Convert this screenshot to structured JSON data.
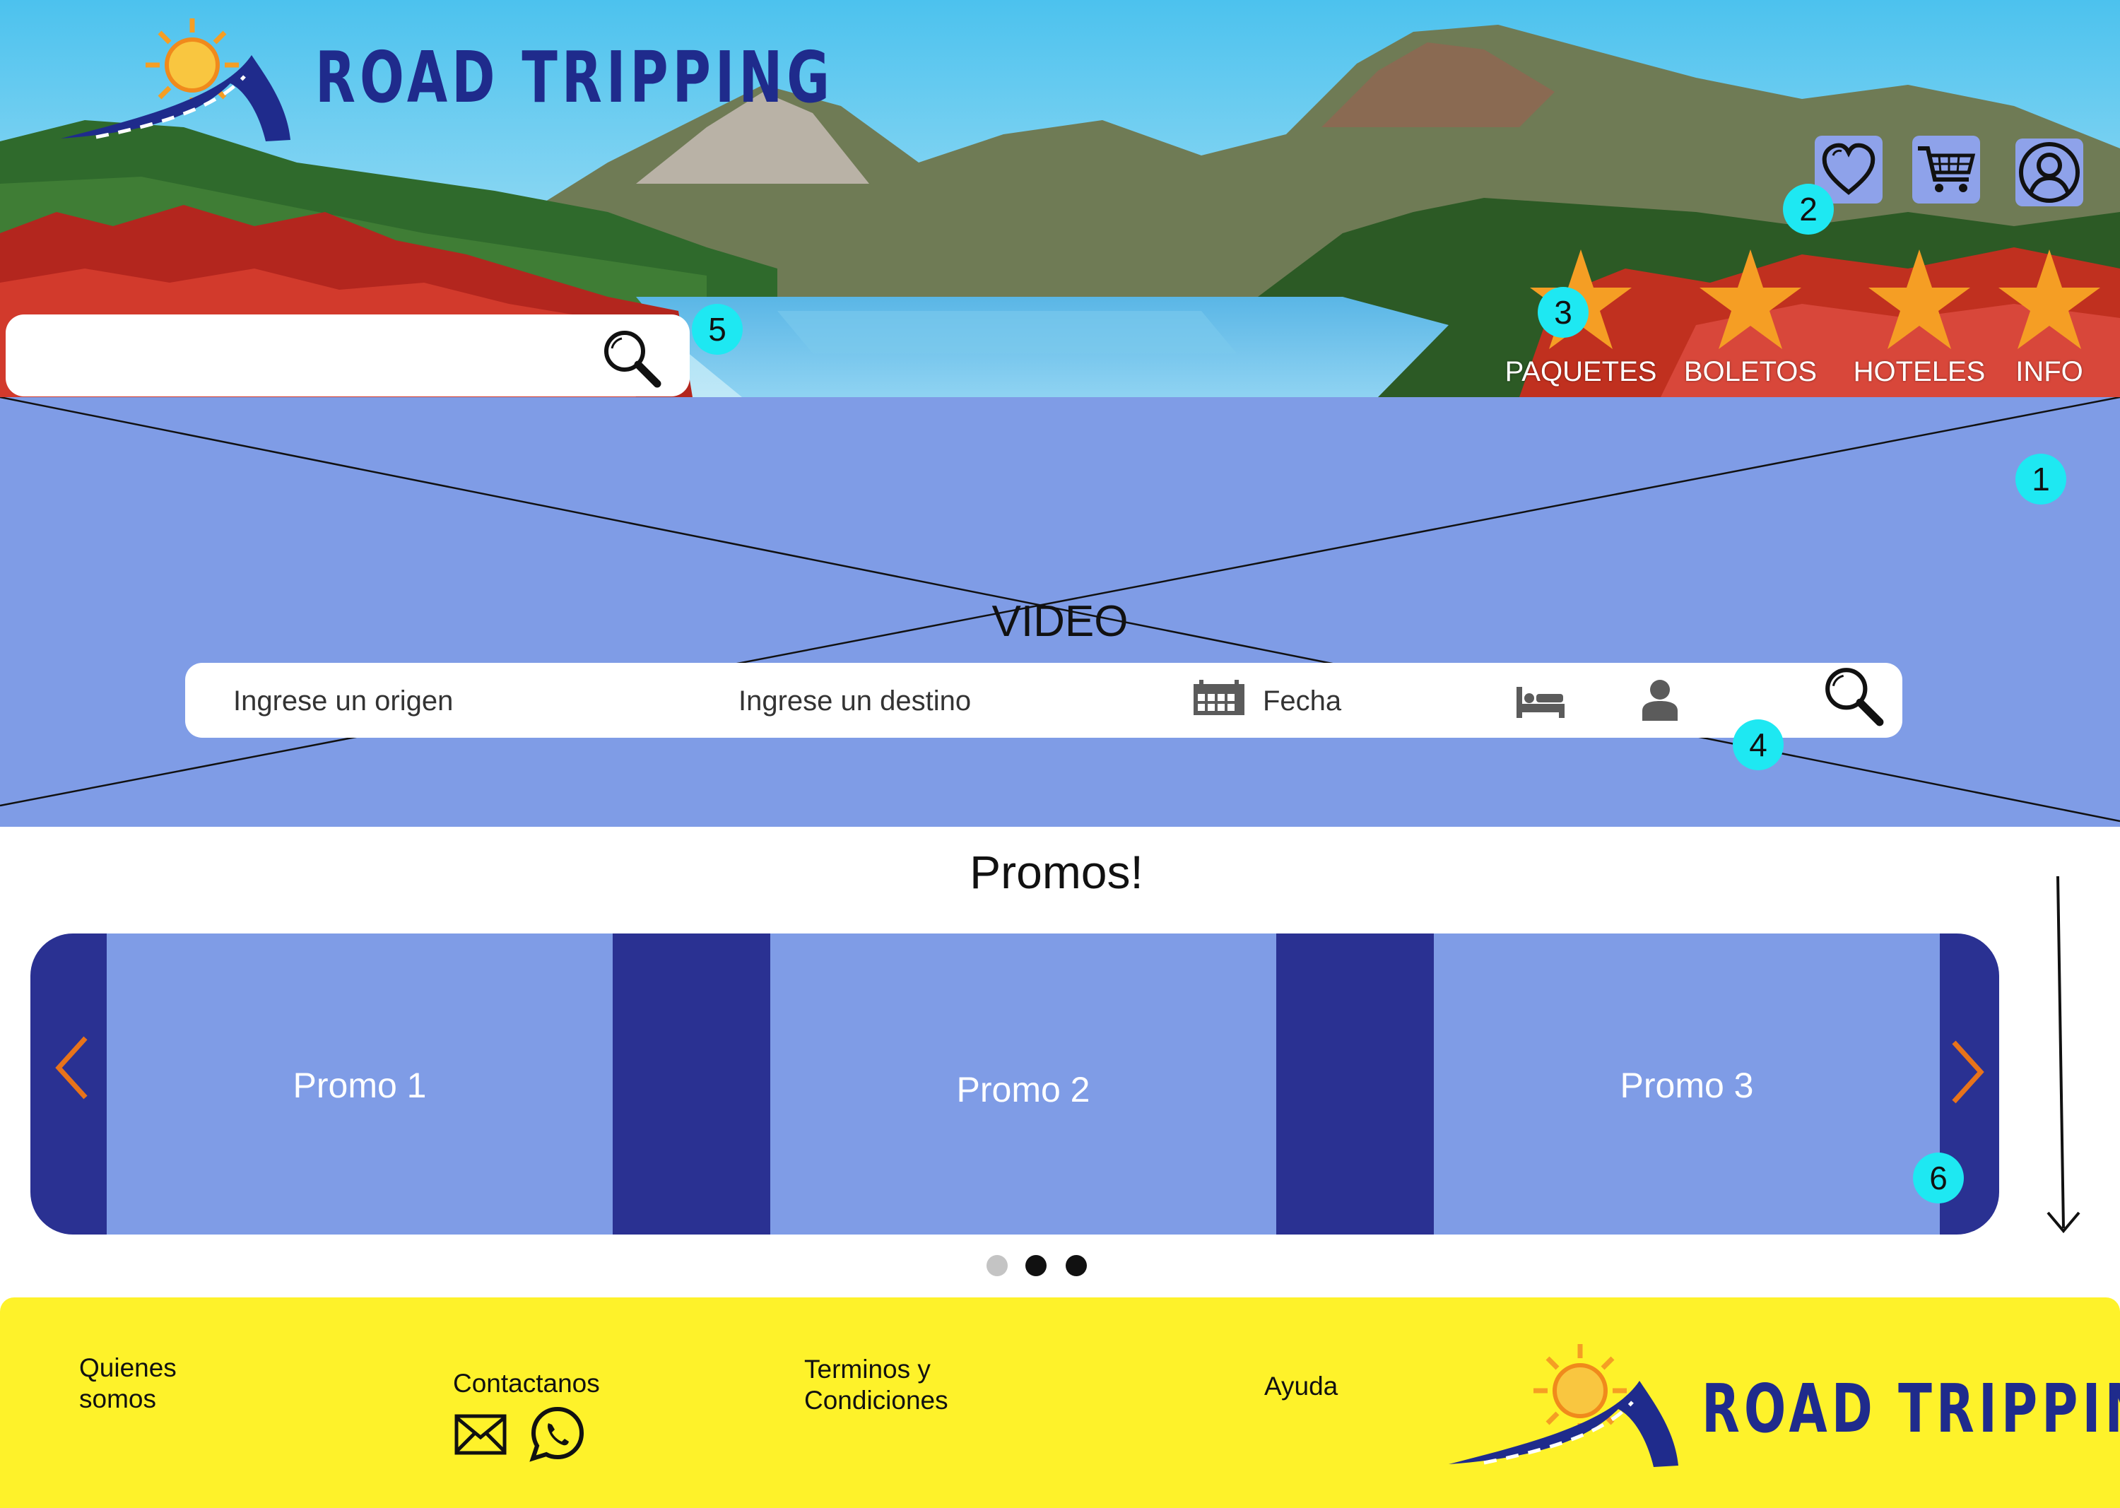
{
  "header": {
    "logo_text": "ROAD TRIPPING",
    "search": {
      "placeholder": ""
    },
    "actions": [
      {
        "id": "favorites",
        "icon": "heart-icon"
      },
      {
        "id": "cart",
        "icon": "cart-icon"
      },
      {
        "id": "account",
        "icon": "user-icon"
      }
    ],
    "nav": [
      {
        "label": "PAQUETES",
        "icon": "star-icon"
      },
      {
        "label": "BOLETOS",
        "icon": "star-icon"
      },
      {
        "label": "HOTELES",
        "icon": "star-icon"
      },
      {
        "label": "INFO",
        "icon": "star-icon"
      }
    ]
  },
  "annotations": [
    "1",
    "2",
    "3",
    "4",
    "5",
    "6"
  ],
  "video": {
    "title": "VIDEO",
    "trip_search": {
      "origin_placeholder": "Ingrese un origen",
      "destination_placeholder": "Ingrese un destino",
      "date_label": "Fecha",
      "icons": [
        "calendar-icon",
        "bed-icon",
        "person-icon",
        "search-icon"
      ]
    }
  },
  "promos": {
    "title": "Promos!",
    "items": [
      {
        "label": "Promo 1"
      },
      {
        "label": "Promo 2"
      },
      {
        "label": "Promo 3"
      }
    ],
    "pagination_count": 3,
    "active_index": 0
  },
  "footer": {
    "links": [
      {
        "label": "Quienes\nsomos"
      },
      {
        "label": "Contactanos"
      },
      {
        "label": "Terminos y\nCondiciones"
      },
      {
        "label": "Ayuda"
      }
    ],
    "contact_icons": [
      "mail-icon",
      "whatsapp-icon"
    ],
    "logo_text": "ROAD TRIPPING"
  },
  "colors": {
    "accent_blue": "#7f9ce6",
    "dark_blue": "#2a3192",
    "footer_yellow": "#fef22a",
    "star_orange": "#f59e24",
    "marker_cyan": "#1ee8f2",
    "arrow_orange": "#e8731a"
  }
}
